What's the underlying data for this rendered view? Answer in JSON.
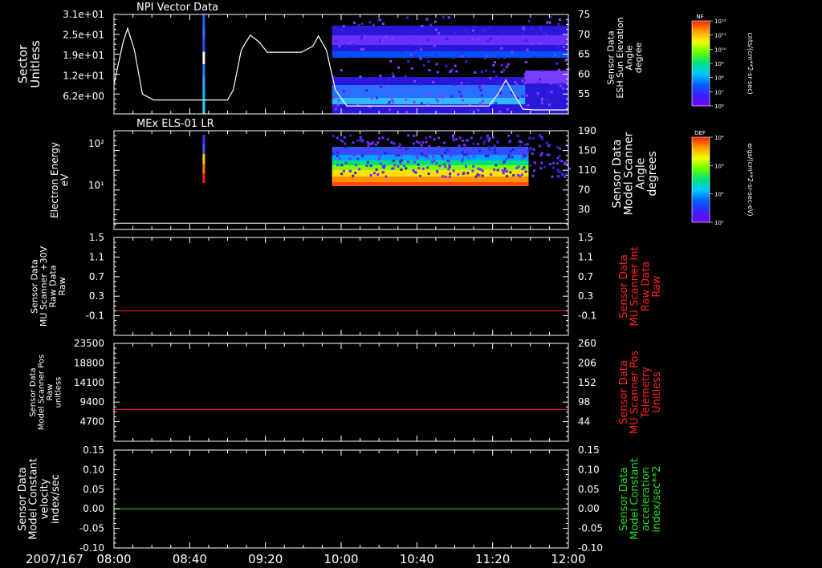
{
  "time_axis": {
    "date_label": "2007/167",
    "ticks": [
      "08:00",
      "08:40",
      "09:20",
      "10:00",
      "10:40",
      "11:20",
      "12:00"
    ],
    "range_hours": [
      8.0,
      12.0
    ]
  },
  "chart_data": [
    {
      "type": "heatmap",
      "title": "NPI Vector Data",
      "ylabel_left": [
        "Sector",
        "Unitless"
      ],
      "ylabel_right": [
        "Sensor Data",
        "ESH Sun Elevation",
        "Angle",
        "degree"
      ],
      "y_ticks_left": [
        "3.1e+01",
        "2.5e+01",
        "1.9e+01",
        "1.2e+01",
        "6.2e+00"
      ],
      "y_ticks_right": [
        "75",
        "70",
        "65",
        "60",
        "55"
      ],
      "ylim_right": [
        50,
        75
      ],
      "line_series": {
        "name": "ESH Sun Elevation Angle",
        "color": "#ffffff",
        "x": [
          8.0,
          8.08,
          8.12,
          8.18,
          8.25,
          8.35,
          8.6,
          9.0,
          9.05,
          9.12,
          9.2,
          9.28,
          9.35,
          9.5,
          9.65,
          9.75,
          9.8,
          9.87,
          9.95,
          10.05,
          10.15,
          11.1,
          11.3,
          11.38,
          11.45,
          11.52,
          11.6,
          11.7,
          12.0
        ],
        "y": [
          57.5,
          68,
          71.5,
          66,
          55,
          53.5,
          53.5,
          53.5,
          56,
          66,
          69.8,
          68,
          65.5,
          65.5,
          65.5,
          67,
          69.6,
          66,
          56,
          52,
          52,
          52,
          52,
          55,
          58.5,
          55,
          51.2,
          51,
          51
        ]
      },
      "colorbar": {
        "label": "NF",
        "units": "cnts/(cm**2-sr-sec)",
        "ticks": [
          "10¹²",
          "10¹¹",
          "10¹⁰",
          "10⁹",
          "10⁸",
          "10⁷",
          "10⁶"
        ]
      }
    },
    {
      "type": "heatmap",
      "title": "MEx ELS-01 LR",
      "ylabel_left": [
        "Electron Energy",
        "eV"
      ],
      "ylabel_right": [
        "Sensor Data",
        "Model Scanner",
        "Angle",
        "degrees"
      ],
      "y_ticks_left": [
        "10²",
        "10¹"
      ],
      "y_ticks_right": [
        "190",
        "150",
        "110",
        "70",
        "30"
      ],
      "ylim_right": [
        0,
        190
      ],
      "line_series": {
        "name": "Model Scanner Angle",
        "color": "#ffffff",
        "x": [
          8.0,
          12.0
        ],
        "y": [
          12,
          12
        ]
      },
      "colorbar": {
        "label": "DEF",
        "units": "ergs/(cm**2-sr-sec-eV)",
        "ticks": [
          "10⁴",
          "10³",
          "10²",
          "10¹"
        ]
      }
    },
    {
      "type": "line",
      "ylabel_left": [
        "Sensor Data",
        "MU Scanner +30V",
        "Raw Data",
        "Raw"
      ],
      "ylabel_right": [
        "Sensor Data",
        "MU Scanner Int",
        "Raw Data",
        "Raw"
      ],
      "y_ticks_left": [
        "1.5",
        "1.1",
        "0.7",
        "0.3",
        "-0.1"
      ],
      "y_ticks_right": [
        "1.5",
        "1.1",
        "0.7",
        "0.3",
        "-0.1"
      ],
      "ylim": [
        -0.5,
        1.5
      ],
      "series": [
        {
          "name": "MU Scanner +30V",
          "color": "#ff2020",
          "x": [
            8.0,
            12.0
          ],
          "values": [
            0.0,
            0.0
          ]
        }
      ]
    },
    {
      "type": "line",
      "ylabel_left": [
        "Sensor Data",
        "Model Scanner Pos",
        "Raw",
        "unitless"
      ],
      "ylabel_right": [
        "Sensor Data",
        "MU Scanner Pos",
        "Telemetry",
        "Unitless"
      ],
      "y_ticks_left": [
        "23500",
        "18800",
        "14100",
        "9400",
        "4700"
      ],
      "y_ticks_right": [
        "260",
        "206",
        "152",
        "98",
        "44"
      ],
      "ylim": [
        0,
        23500
      ],
      "series": [
        {
          "name": "Model Scanner Pos",
          "color": "#ff2020",
          "x": [
            8.0,
            12.0
          ],
          "values": [
            7650,
            7650
          ]
        }
      ]
    },
    {
      "type": "line",
      "ylabel_left": [
        "Sensor Data",
        "Model Constant",
        "velocity",
        "index/sec"
      ],
      "ylabel_right": [
        "Sensor Data",
        "Model Constant",
        "acceleration",
        "index/sec**2"
      ],
      "y_ticks_left": [
        "0.15",
        "0.10",
        "0.05",
        "0.00",
        "-0.05",
        "-0.10"
      ],
      "y_ticks_right": [
        "0.15",
        "0.10",
        "0.05",
        "0.00",
        "-0.05",
        "-0.10"
      ],
      "ylim": [
        -0.1,
        0.15
      ],
      "series": [
        {
          "name": "Model Constant velocity",
          "color": "#20e020",
          "x": [
            8.0,
            12.0
          ],
          "values": [
            0.0,
            0.0
          ]
        }
      ]
    }
  ],
  "colors": {
    "background": "#000000",
    "axes": "#ffffff",
    "red_label": "#ff2020",
    "green_label": "#20e020"
  }
}
